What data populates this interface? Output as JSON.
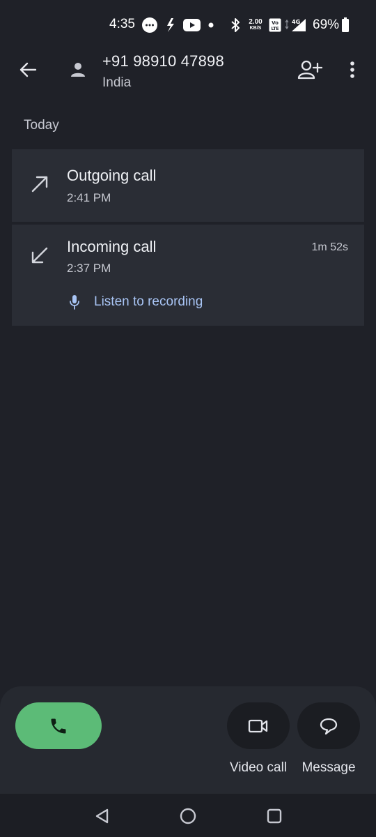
{
  "status_bar": {
    "time": "4:35",
    "net_speed_value": "2.00",
    "net_speed_unit": "KB/S",
    "battery": "69%",
    "icons": [
      "messages-icon",
      "bolt-icon",
      "youtube-icon",
      "dot-icon",
      "bluetooth-icon",
      "volte-icon",
      "signal-4g-icon",
      "battery-icon"
    ]
  },
  "header": {
    "number": "+91 98910 47898",
    "location": "India"
  },
  "section": {
    "title": "Today"
  },
  "calls": [
    {
      "type": "Outgoing call",
      "time": "2:41 PM",
      "icon": "outgoing-arrow-icon"
    },
    {
      "type": "Incoming call",
      "time": "2:37 PM",
      "duration": "1m 52s",
      "icon": "incoming-arrow-icon",
      "recording_label": "Listen to recording"
    }
  ],
  "actions": {
    "video_label": "Video call",
    "message_label": "Message"
  },
  "colors": {
    "background": "#1f2128",
    "card": "#2a2d35",
    "call_button": "#5cbb77",
    "link": "#a8c4f4"
  }
}
